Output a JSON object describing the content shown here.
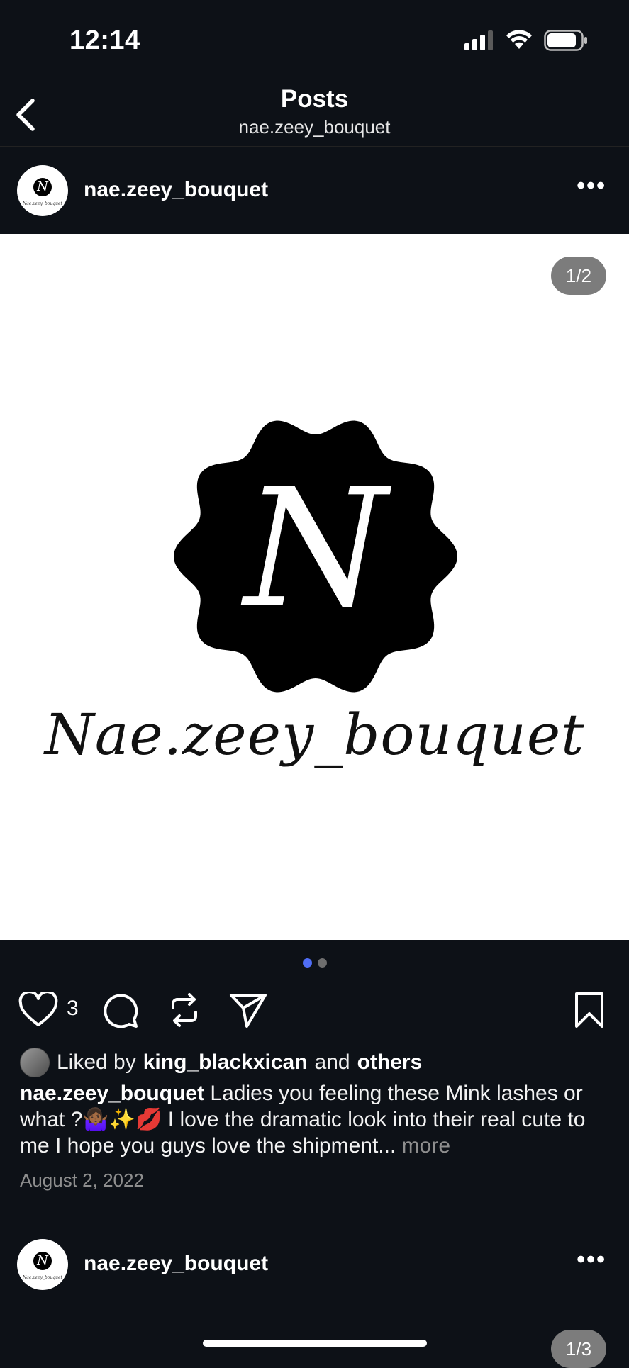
{
  "status_bar": {
    "time": "12:14"
  },
  "nav": {
    "title": "Posts",
    "subtitle": "nae.zeey_bouquet"
  },
  "post": {
    "username": "nae.zeey_bouquet",
    "image_counter": "1/2",
    "logo_letter": "N",
    "logo_wordmark": "Nae.zeey_bouquet",
    "avatar_mini_text": "Nae.zeey_bouquet",
    "carousel": {
      "count": 2,
      "active_index": 0,
      "active_color": "#4f6df5",
      "inactive_color": "#6e6e6e"
    },
    "like_count": "3",
    "liked_by_prefix": "Liked by",
    "liked_by_user": "king_blackxican",
    "liked_by_and": "and",
    "liked_by_others": "others",
    "caption_user": "nae.zeey_bouquet",
    "caption_text": "Ladies you feeling these Mink lashes or what ?🤷🏾‍♀️✨💋 I love the dramatic look into their real cute to me I hope you guys love the shipment...",
    "caption_more": "more",
    "date": "August 2, 2022",
    "icons": [
      "heart-icon",
      "comment-icon",
      "repost-icon",
      "share-icon",
      "bookmark-icon"
    ]
  },
  "next_post": {
    "username": "nae.zeey_bouquet",
    "image_counter": "1/3",
    "avatar_mini_text": "Nae.zeey_bouquet"
  },
  "colors": {
    "background": "#0d1117",
    "text": "#ffffff",
    "muted": "#8e8e8e",
    "accent": "#4f6df5"
  }
}
